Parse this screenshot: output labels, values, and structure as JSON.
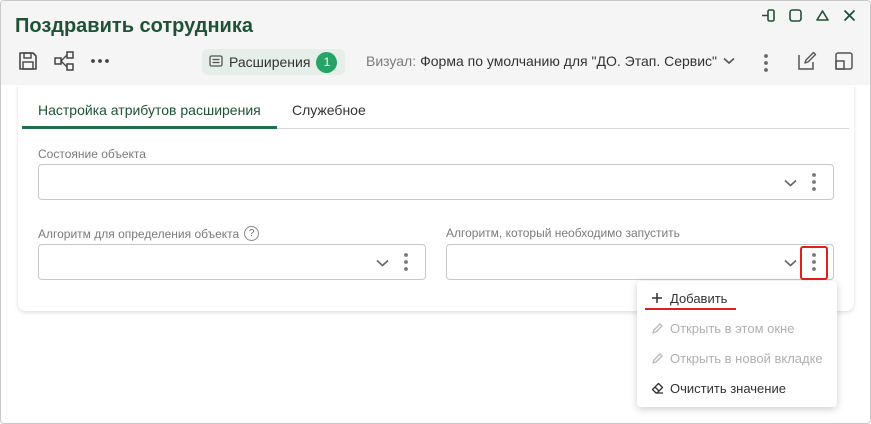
{
  "window": {
    "title": "Поздравить сотрудника",
    "controls": [
      "pin-icon",
      "maximize-icon",
      "collapse-icon",
      "close-icon"
    ]
  },
  "toolbar": {
    "icons": [
      "save-icon",
      "structure-icon",
      "more-icon"
    ],
    "extensions_label": "Расширения",
    "extensions_count": "1",
    "visual_label": "Визуал:",
    "visual_value": "Форма по умолчанию для \"ДО. Этап. Сервис\"",
    "right_icons": [
      "edit-icon",
      "layout-icon"
    ]
  },
  "tabs": [
    {
      "label": "Настройка атрибутов расширения",
      "active": true
    },
    {
      "label": "Служебное",
      "active": false
    }
  ],
  "fields": {
    "object_state": {
      "label": "Состояние объекта",
      "value": ""
    },
    "object_algorithm": {
      "label": "Алгоритм для определения объекта",
      "help": "?",
      "value": ""
    },
    "run_algorithm": {
      "label": "Алгоритм, который необходимо запустить",
      "value": ""
    }
  },
  "context_menu": {
    "items": [
      {
        "label": "Добавить",
        "icon": "plus-icon",
        "enabled": true
      },
      {
        "label": "Открыть в этом окне",
        "icon": "pencil-icon",
        "enabled": false
      },
      {
        "label": "Открыть в новой вкладке",
        "icon": "pencil-icon",
        "enabled": false
      },
      {
        "label": "Очистить значение",
        "icon": "eraser-icon",
        "enabled": true
      }
    ]
  },
  "colors": {
    "title": "#1f5236",
    "accent": "#27a367",
    "header_bg": "#f4f5f4",
    "highlight": "#e02020"
  }
}
